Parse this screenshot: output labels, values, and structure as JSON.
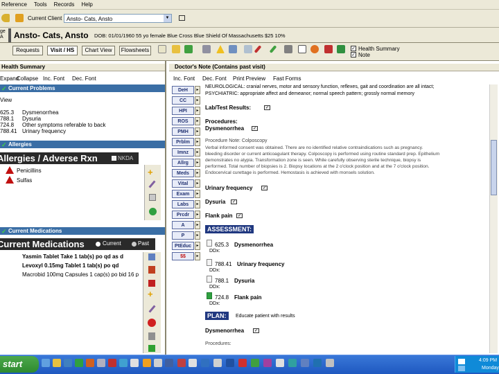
{
  "menu": [
    "Reference",
    "Tools",
    "Records",
    "Help"
  ],
  "patient": {
    "label": "Current Client",
    "value": "Ansto- Cats, Ansto",
    "info_name": "Ansto- Cats, Ansto",
    "info_rest": "DOB: 01/01/1960 55 yo female   Blue Cross Blue Shield Of Massachusetts  $25   10%"
  },
  "tabs": [
    "Requests",
    "Visit / HS",
    "Chart View",
    "Flowsheets"
  ],
  "checks": [
    "Health Summary",
    "Note"
  ],
  "left": {
    "header": "Health Summary",
    "actions": [
      "Expand",
      "Collapse",
      "Inc. Font",
      "Dec. Font"
    ],
    "problems_title": "Current Problems",
    "view_label": "View",
    "problems": [
      {
        "code": "625.3",
        "name": "Dysmenorrhea"
      },
      {
        "code": "788.1",
        "name": "Dysuria"
      },
      {
        "code": "724.8",
        "name": "Other symptoms referable to back"
      },
      {
        "code": "788.41",
        "name": "Urinary frequency"
      }
    ],
    "allergies_title": "Allergies",
    "allergies_big": "Allergies / Adverse Rxn",
    "nkda": "NKDA",
    "allergies": [
      "Penicillins",
      "Sulfas"
    ],
    "meds_title": "Current Medications",
    "meds_big": "Current Medications",
    "meds_opt_current": "Current",
    "meds_opt_past": "Past",
    "meds": [
      "Yasmin Tablet Take 1 tab(s) po qd as d",
      "Levoxyl 0.15mg Tablet 1 tab(s) po qd",
      "Macrobid 100mg Capsules 1 cap(s) po bid  16 p"
    ]
  },
  "right": {
    "header": "Doctor's Note (Contains past visit)",
    "actions": [
      "Inc. Font",
      "Dec. Font",
      "Print Preview",
      "Fast Forms"
    ],
    "side_buttons": [
      "DeH",
      "CC",
      "HPI",
      "ROS",
      "PMH",
      "Prblm",
      "Imnz",
      "Allrg",
      "Meds",
      "Vital",
      "Exam",
      "Labs",
      "Prcdr",
      "A",
      "P",
      "PtEduc",
      "$$"
    ],
    "neuro": "NEUROLOGICAL: cranial nerves, motor and sensory function, reflexes, gait and coordination are all intact;",
    "psych": "PSYCHIATRIC: appropriate affect and demeanor; normal speech pattern; grossly normal memory",
    "lab_results": "Lab/Test Results:",
    "procedures": "Procedures:",
    "proc_item": "Dysmenorrhea",
    "colpo_title": "Procedure Note: Colposcopy",
    "colpo_lines": [
      "Verbal informed consent was obtained.    There are no identified relative contraindications such as pregnancy.",
      "bleeding disorder or current anticoagulant therapy.    Colposcopy is performed using routine standard prep.    Epithelium",
      "demonstrates no atypia.    Transformation zone is seen.    While carefully observing sterile technique, biopsy is",
      "performed. Total number of biopsies is 2.    Biopsy locations at the 2 o'clock position and at the 7 o'clock position.",
      "Endocervical curettage is performed.    Hemostasis is achieved with monsels solution."
    ],
    "findings": [
      "Urinary frequency",
      "Dysuria",
      "Flank pain"
    ],
    "assessment": "ASSESSMENT:",
    "assess_items": [
      {
        "code": "625.3",
        "name": "Dysmenorrhea",
        "dd": "DDx:"
      },
      {
        "code": "788.41",
        "name": "Urinary frequency",
        "dd": "DDx:"
      },
      {
        "code": "788.1",
        "name": "Dysuria",
        "dd": "DDx:"
      },
      {
        "code": "724.8",
        "name": "Flank pain",
        "dd": "DDx:"
      }
    ],
    "plan": "PLAN:",
    "plan_text": "Educate patient with results",
    "plan_item": "Dysmenorrhea",
    "plan_next": "Procedures:"
  },
  "taskbar": {
    "start": "start",
    "time": "4:09 PM",
    "day": "Monday"
  }
}
